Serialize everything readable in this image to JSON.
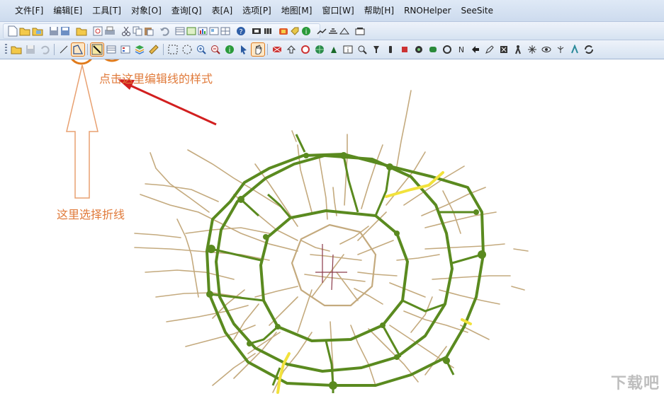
{
  "menu": [
    "文件[F]",
    "编辑[E]",
    "工具[T]",
    "对象[O]",
    "查询[Q]",
    "表[A]",
    "选项[P]",
    "地图[M]",
    "窗口[W]",
    "帮助[H]",
    "RNOHelper",
    "SeeSite"
  ],
  "annotations": {
    "style_hint": "点击这里编辑线的样式",
    "polyline_hint": "这里选择折线"
  },
  "watermark": "下载吧",
  "colors": {
    "highlight": "#e07a1a",
    "arrow": "#d21f1f",
    "ring_road": "#5a8a1f",
    "minor_road": "#c4aa7e",
    "yellow_road": "#f2e23c"
  },
  "toolbar_icons_row1": [
    "new-doc-icon",
    "open-folder-icon",
    "open-table-icon",
    "save-icon",
    "save-copy-icon",
    "open-workspace-icon",
    "print-preview-icon",
    "print-icon",
    "cut-icon",
    "copy-icon",
    "paste-icon",
    "undo-icon",
    "new-browser-icon",
    "new-mapper-icon",
    "new-grapher-icon",
    "new-layout-icon",
    "new-redistrict-icon",
    "help-icon",
    "layer-control-icon",
    "map-tool-icon",
    "ruler-tool-icon",
    "info-tool-icon",
    "label-tool-icon",
    "find-icon",
    "options-icon",
    "sync-icon",
    "tabs-icon"
  ],
  "toolbar_icons_row2": [
    "open-icon",
    "save-disabled-icon",
    "undo-disabled-icon",
    "line-tool-icon",
    "polyline-tool-icon",
    "line-style-icon",
    "browser-icon",
    "legend-icon",
    "layers-icon",
    "ruler-icon",
    "select-icon",
    "radius-select-icon",
    "zoom-in-icon",
    "zoom-out-icon",
    "info-icon",
    "pointer-icon",
    "pan-icon"
  ]
}
